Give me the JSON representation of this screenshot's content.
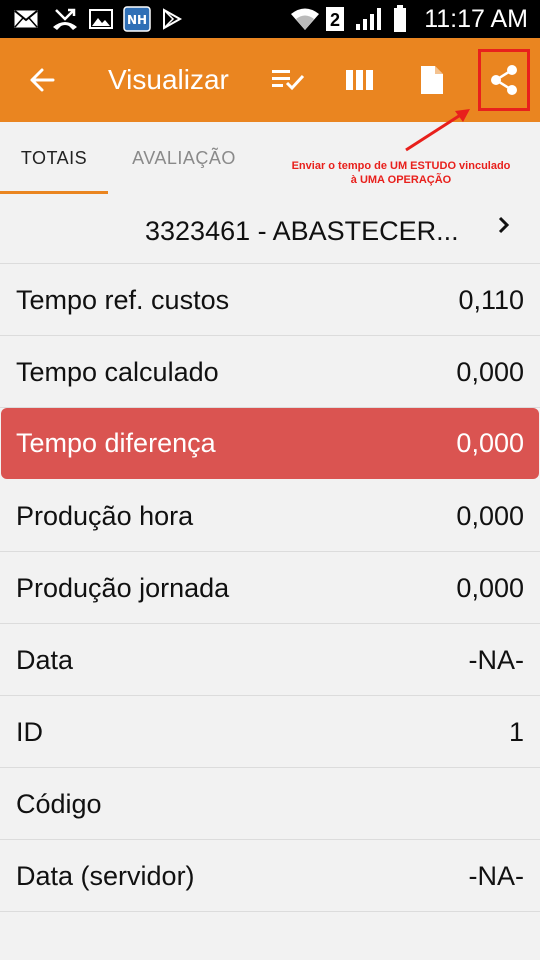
{
  "status_bar": {
    "time": "11:17 AM",
    "sim_number": "2",
    "icons": [
      "mail-icon",
      "missed-call-icon",
      "image-icon",
      "nh-app-icon",
      "play-store-icon",
      "wifi-icon",
      "sim-icon",
      "signal-icon",
      "battery-icon"
    ]
  },
  "app_bar": {
    "title": "Visualizar",
    "icons": [
      "back-arrow-icon",
      "checklist-icon",
      "columns-icon",
      "document-icon",
      "share-icon"
    ]
  },
  "tabs": [
    {
      "label": "TOTAIS",
      "active": true
    },
    {
      "label": "AVALIAÇÃO",
      "active": false
    }
  ],
  "annotation": {
    "line1": "Enviar o tempo de UM ESTUDO vinculado",
    "line2": "à UMA OPERAÇÃO",
    "color": "#e8201c"
  },
  "selector": {
    "text": "3323461 - ABASTECER...",
    "icon": "chevron-right-icon"
  },
  "rows": [
    {
      "label": "Tempo ref. custos",
      "value": "0,110"
    },
    {
      "label": "Tempo calculado",
      "value": "0,000"
    },
    {
      "label": "Tempo diferença",
      "value": "0,000",
      "highlight": true
    },
    {
      "label": "Produção hora",
      "value": "0,000"
    },
    {
      "label": "Produção jornada",
      "value": "0,000"
    },
    {
      "label": "Data",
      "value": "-NA-"
    },
    {
      "label": "ID",
      "value": "1"
    },
    {
      "label": "Código",
      "value": ""
    },
    {
      "label": "Data (servidor)",
      "value": "-NA-"
    }
  ],
  "colors": {
    "primary": "#ea8520",
    "highlight_row": "#da5451",
    "annotation": "#e8201c",
    "background": "#f2f2f2"
  }
}
